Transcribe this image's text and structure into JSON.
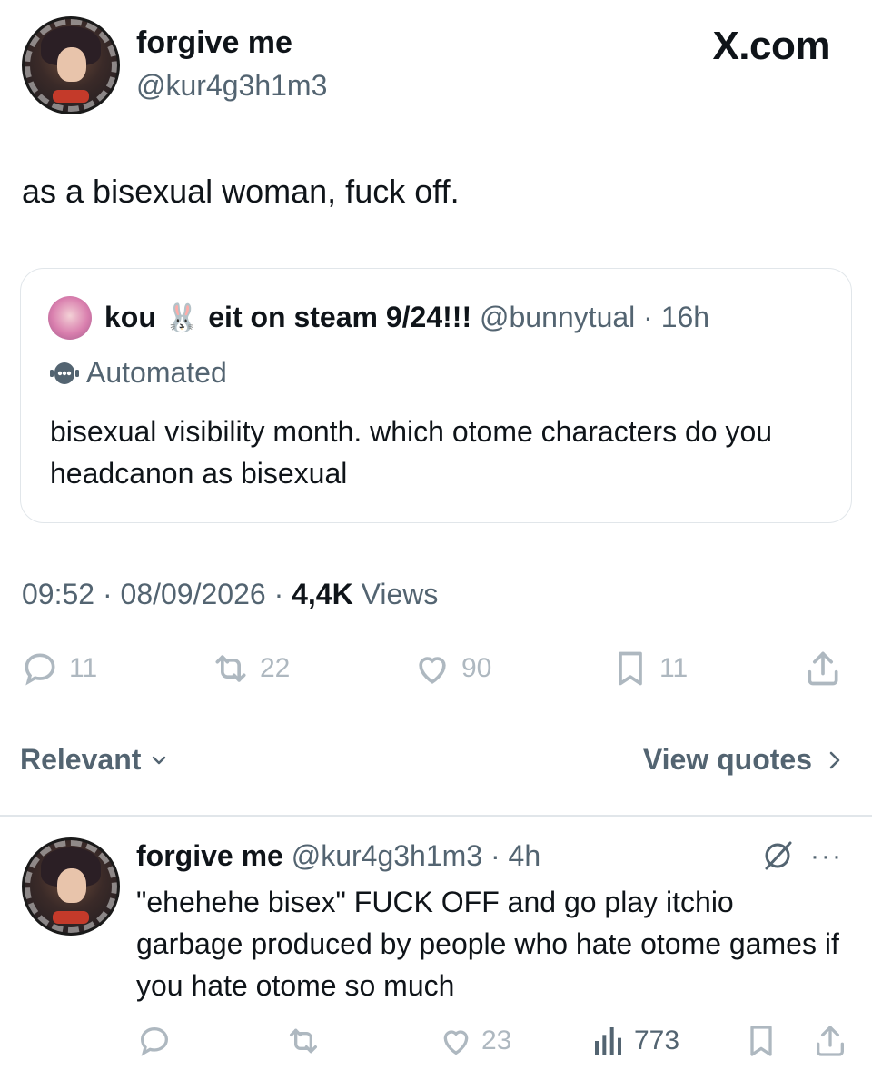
{
  "header": {
    "display_name": "forgive me",
    "handle": "@kur4g3h1m3",
    "brand": "X.com",
    "avatar_icon": "anime-character-avatar"
  },
  "tweet": {
    "text": "as a bisexual woman, fuck off.",
    "timestamp": "09:52 · 08/09/2026 · ",
    "views_count": "4,4K",
    "views_label": " Views",
    "actions": {
      "reply_count": "11",
      "retweet_count": "22",
      "like_count": "90",
      "bookmark_count": "11"
    }
  },
  "quote": {
    "name": "kou",
    "name_emoji": "🐰",
    "name_suffix": "eit on steam 9/24!!!",
    "handle_time": "@bunnytual · 16h",
    "automated_label": "Automated",
    "text": "bisexual visibility month. which otome characters do you headcanon as bisexual"
  },
  "replies_bar": {
    "sort_label": "Relevant",
    "view_quotes_label": "View quotes"
  },
  "reply": {
    "display_name": "forgive me",
    "handle_time": "@kur4g3h1m3 · 4h",
    "text": "\"ehehehe bisex\" FUCK OFF and go play itchio garbage produced by people who hate otome games if you hate otome so much",
    "more": "···",
    "actions": {
      "like_count": "23",
      "views_count": "773"
    }
  },
  "colors": {
    "text": "#0f1419",
    "muted": "#536471",
    "icon_muted": "#aeb8c0",
    "border": "#e1e6ea"
  }
}
